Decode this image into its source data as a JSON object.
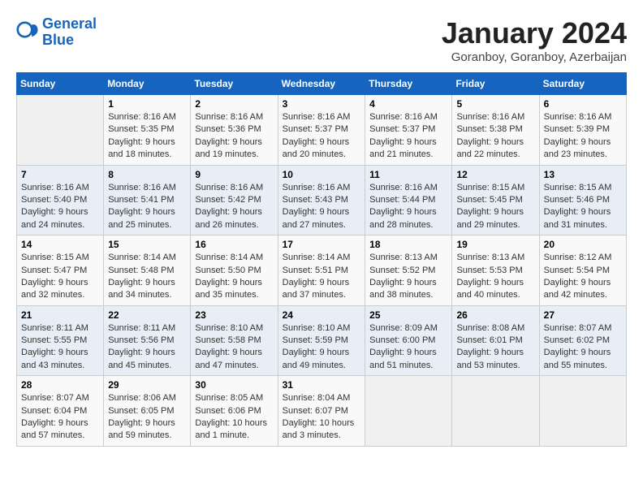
{
  "header": {
    "logo_line1": "General",
    "logo_line2": "Blue",
    "month": "January 2024",
    "location": "Goranboy, Goranboy, Azerbaijan"
  },
  "weekdays": [
    "Sunday",
    "Monday",
    "Tuesday",
    "Wednesday",
    "Thursday",
    "Friday",
    "Saturday"
  ],
  "weeks": [
    [
      {
        "day": "",
        "info": ""
      },
      {
        "day": "1",
        "info": "Sunrise: 8:16 AM\nSunset: 5:35 PM\nDaylight: 9 hours\nand 18 minutes."
      },
      {
        "day": "2",
        "info": "Sunrise: 8:16 AM\nSunset: 5:36 PM\nDaylight: 9 hours\nand 19 minutes."
      },
      {
        "day": "3",
        "info": "Sunrise: 8:16 AM\nSunset: 5:37 PM\nDaylight: 9 hours\nand 20 minutes."
      },
      {
        "day": "4",
        "info": "Sunrise: 8:16 AM\nSunset: 5:37 PM\nDaylight: 9 hours\nand 21 minutes."
      },
      {
        "day": "5",
        "info": "Sunrise: 8:16 AM\nSunset: 5:38 PM\nDaylight: 9 hours\nand 22 minutes."
      },
      {
        "day": "6",
        "info": "Sunrise: 8:16 AM\nSunset: 5:39 PM\nDaylight: 9 hours\nand 23 minutes."
      }
    ],
    [
      {
        "day": "7",
        "info": "Sunrise: 8:16 AM\nSunset: 5:40 PM\nDaylight: 9 hours\nand 24 minutes."
      },
      {
        "day": "8",
        "info": "Sunrise: 8:16 AM\nSunset: 5:41 PM\nDaylight: 9 hours\nand 25 minutes."
      },
      {
        "day": "9",
        "info": "Sunrise: 8:16 AM\nSunset: 5:42 PM\nDaylight: 9 hours\nand 26 minutes."
      },
      {
        "day": "10",
        "info": "Sunrise: 8:16 AM\nSunset: 5:43 PM\nDaylight: 9 hours\nand 27 minutes."
      },
      {
        "day": "11",
        "info": "Sunrise: 8:16 AM\nSunset: 5:44 PM\nDaylight: 9 hours\nand 28 minutes."
      },
      {
        "day": "12",
        "info": "Sunrise: 8:15 AM\nSunset: 5:45 PM\nDaylight: 9 hours\nand 29 minutes."
      },
      {
        "day": "13",
        "info": "Sunrise: 8:15 AM\nSunset: 5:46 PM\nDaylight: 9 hours\nand 31 minutes."
      }
    ],
    [
      {
        "day": "14",
        "info": "Sunrise: 8:15 AM\nSunset: 5:47 PM\nDaylight: 9 hours\nand 32 minutes."
      },
      {
        "day": "15",
        "info": "Sunrise: 8:14 AM\nSunset: 5:48 PM\nDaylight: 9 hours\nand 34 minutes."
      },
      {
        "day": "16",
        "info": "Sunrise: 8:14 AM\nSunset: 5:50 PM\nDaylight: 9 hours\nand 35 minutes."
      },
      {
        "day": "17",
        "info": "Sunrise: 8:14 AM\nSunset: 5:51 PM\nDaylight: 9 hours\nand 37 minutes."
      },
      {
        "day": "18",
        "info": "Sunrise: 8:13 AM\nSunset: 5:52 PM\nDaylight: 9 hours\nand 38 minutes."
      },
      {
        "day": "19",
        "info": "Sunrise: 8:13 AM\nSunset: 5:53 PM\nDaylight: 9 hours\nand 40 minutes."
      },
      {
        "day": "20",
        "info": "Sunrise: 8:12 AM\nSunset: 5:54 PM\nDaylight: 9 hours\nand 42 minutes."
      }
    ],
    [
      {
        "day": "21",
        "info": "Sunrise: 8:11 AM\nSunset: 5:55 PM\nDaylight: 9 hours\nand 43 minutes."
      },
      {
        "day": "22",
        "info": "Sunrise: 8:11 AM\nSunset: 5:56 PM\nDaylight: 9 hours\nand 45 minutes."
      },
      {
        "day": "23",
        "info": "Sunrise: 8:10 AM\nSunset: 5:58 PM\nDaylight: 9 hours\nand 47 minutes."
      },
      {
        "day": "24",
        "info": "Sunrise: 8:10 AM\nSunset: 5:59 PM\nDaylight: 9 hours\nand 49 minutes."
      },
      {
        "day": "25",
        "info": "Sunrise: 8:09 AM\nSunset: 6:00 PM\nDaylight: 9 hours\nand 51 minutes."
      },
      {
        "day": "26",
        "info": "Sunrise: 8:08 AM\nSunset: 6:01 PM\nDaylight: 9 hours\nand 53 minutes."
      },
      {
        "day": "27",
        "info": "Sunrise: 8:07 AM\nSunset: 6:02 PM\nDaylight: 9 hours\nand 55 minutes."
      }
    ],
    [
      {
        "day": "28",
        "info": "Sunrise: 8:07 AM\nSunset: 6:04 PM\nDaylight: 9 hours\nand 57 minutes."
      },
      {
        "day": "29",
        "info": "Sunrise: 8:06 AM\nSunset: 6:05 PM\nDaylight: 9 hours\nand 59 minutes."
      },
      {
        "day": "30",
        "info": "Sunrise: 8:05 AM\nSunset: 6:06 PM\nDaylight: 10 hours\nand 1 minute."
      },
      {
        "day": "31",
        "info": "Sunrise: 8:04 AM\nSunset: 6:07 PM\nDaylight: 10 hours\nand 3 minutes."
      },
      {
        "day": "",
        "info": ""
      },
      {
        "day": "",
        "info": ""
      },
      {
        "day": "",
        "info": ""
      }
    ]
  ]
}
